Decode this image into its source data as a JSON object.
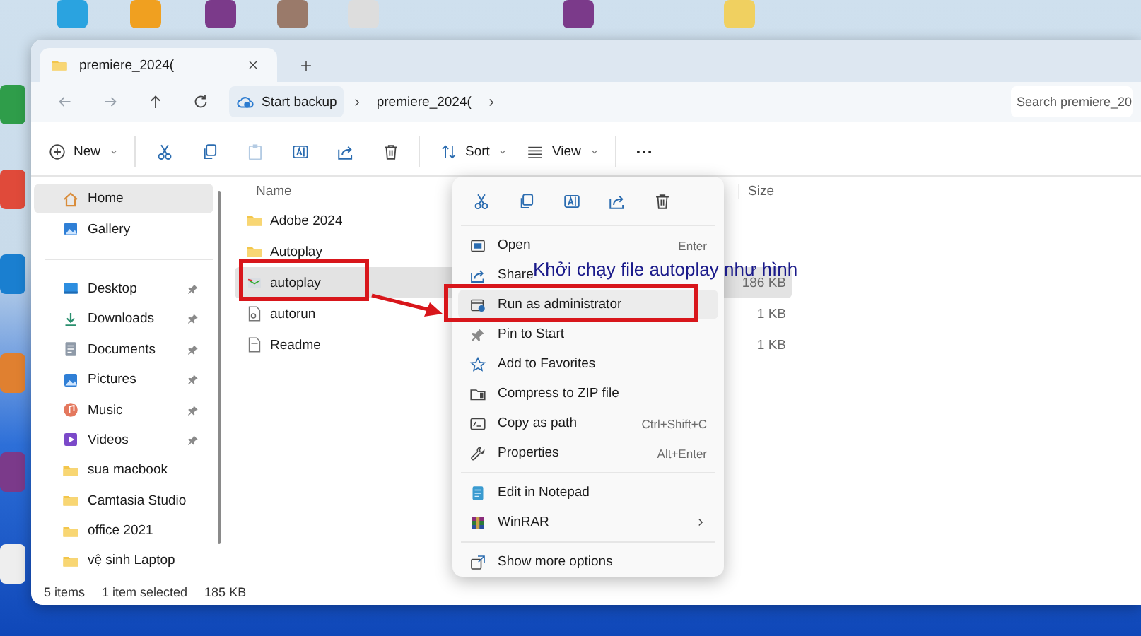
{
  "window": {
    "tab": {
      "title": "premiere_2024(",
      "selected": true
    },
    "address_bar": {
      "breadcrumbs": [
        {
          "label": "Start backup",
          "kind": "backup"
        },
        {
          "label": "premiere_2024(",
          "kind": "folder"
        }
      ],
      "search": {
        "placeholder": "Search premiere_20"
      }
    },
    "toolbar": [
      {
        "kind": "new",
        "label": "New",
        "disabled": false
      },
      {
        "kind": "cut",
        "disabled": false
      },
      {
        "kind": "copy",
        "disabled": false
      },
      {
        "kind": "paste",
        "disabled": true
      },
      {
        "kind": "rename",
        "disabled": false
      },
      {
        "kind": "share",
        "disabled": false
      },
      {
        "kind": "delete",
        "disabled": false
      },
      {
        "kind": "sort",
        "label": "Sort",
        "disabled": false
      },
      {
        "kind": "view",
        "label": "View",
        "disabled": false
      },
      {
        "kind": "more",
        "disabled": false
      }
    ],
    "sidebar": {
      "sections": [
        {
          "items": [
            {
              "label": "Home",
              "kind": "home",
              "selected": true,
              "pinned": false
            },
            {
              "label": "Gallery",
              "kind": "gallery",
              "selected": false,
              "pinned": false
            }
          ]
        },
        {
          "items": [
            {
              "label": "Desktop",
              "kind": "desktop",
              "selected": false,
              "pinned": true
            },
            {
              "label": "Downloads",
              "kind": "downloads",
              "selected": false,
              "pinned": true
            },
            {
              "label": "Documents",
              "kind": "documents",
              "selected": false,
              "pinned": true
            },
            {
              "label": "Pictures",
              "kind": "pictures",
              "selected": false,
              "pinned": true
            },
            {
              "label": "Music",
              "kind": "music",
              "selected": false,
              "pinned": true
            },
            {
              "label": "Videos",
              "kind": "videos",
              "selected": false,
              "pinned": true
            },
            {
              "label": "sua macbook",
              "kind": "folder",
              "selected": false,
              "pinned": false
            },
            {
              "label": "Camtasia Studio",
              "kind": "folder",
              "selected": false,
              "pinned": false
            },
            {
              "label": "office 2021",
              "kind": "folder",
              "selected": false,
              "pinned": false
            },
            {
              "label": "vệ sinh Laptop",
              "kind": "folder",
              "selected": false,
              "pinned": false
            }
          ]
        }
      ]
    },
    "files": {
      "columns": [
        "Name",
        "Size"
      ],
      "rows": [
        {
          "name": "Adobe 2024",
          "kind": "folder",
          "selected": false
        },
        {
          "name": "Autoplay",
          "kind": "folder",
          "selected": false
        },
        {
          "name": "autoplay",
          "kind": "app",
          "size": "186 KB",
          "selected": true
        },
        {
          "name": "autorun",
          "kind": "settings-file",
          "size": "1 KB",
          "selected": false
        },
        {
          "name": "Readme",
          "kind": "text-file",
          "size": "1 KB",
          "selected": false
        }
      ]
    },
    "status_bar": {
      "item_count": "5 items",
      "selection": "1 item selected",
      "selection_size": "185 KB"
    }
  },
  "context_menu": {
    "quick_actions": [
      {
        "kind": "cut"
      },
      {
        "kind": "copy"
      },
      {
        "kind": "rename"
      },
      {
        "kind": "share"
      },
      {
        "kind": "delete"
      }
    ],
    "sections": [
      {
        "items": [
          {
            "label": "Open",
            "shortcut": "Enter",
            "kind": "open",
            "hovered": false
          },
          {
            "label": "Share",
            "kind": "share",
            "hovered": false
          },
          {
            "label": "Run as administrator",
            "kind": "admin",
            "hovered": true
          },
          {
            "label": "Pin to Start",
            "kind": "pin",
            "hovered": false
          },
          {
            "label": "Add to Favorites",
            "kind": "star",
            "hovered": false
          },
          {
            "label": "Compress to ZIP file",
            "kind": "zip",
            "hovered": false
          },
          {
            "label": "Copy as path",
            "shortcut": "Ctrl+Shift+C",
            "kind": "path",
            "hovered": false
          },
          {
            "label": "Properties",
            "shortcut": "Alt+Enter",
            "kind": "wrench",
            "hovered": false
          }
        ]
      },
      {
        "items": [
          {
            "label": "Edit in Notepad",
            "kind": "notepad",
            "hovered": false
          },
          {
            "label": "WinRAR",
            "kind": "archive",
            "submenu": true,
            "hovered": false
          }
        ]
      },
      {
        "items": [
          {
            "label": "Show more options",
            "kind": "more-options",
            "hovered": false
          }
        ]
      }
    ]
  },
  "annotation": {
    "text": "Khởi chạy file autoplay như hình"
  }
}
